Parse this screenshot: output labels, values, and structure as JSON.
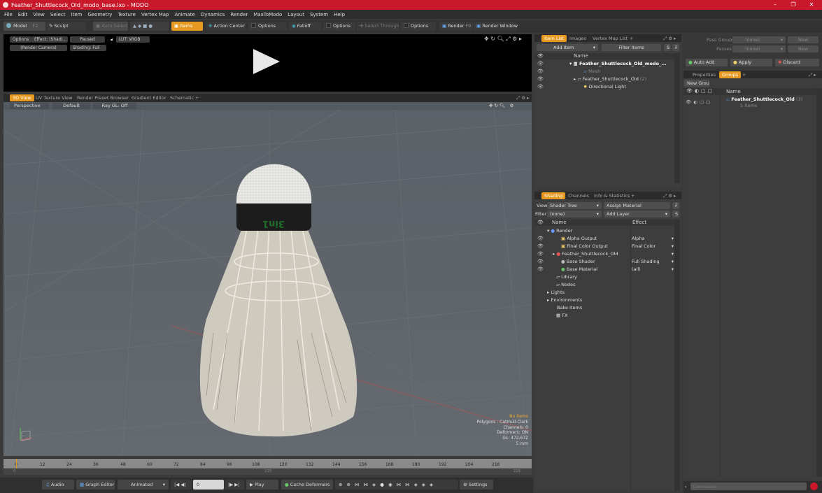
{
  "window": {
    "title": "Feather_Shuttlecock_Old_modo_base.lxo - MODO",
    "min": "–",
    "max": "❐",
    "close": "✕"
  },
  "menu": [
    "File",
    "Edit",
    "View",
    "Select",
    "Item",
    "Geometry",
    "Texture",
    "Vertex Map",
    "Animate",
    "Dynamics",
    "Render",
    "MaxToModo",
    "Layout",
    "System",
    "Help"
  ],
  "toolbar": {
    "model": "Model",
    "f2": "F2",
    "sculpt": "Sculpt",
    "auto_select": "Auto Select",
    "items": "Items",
    "action_center": "Action Center",
    "options1": "Options",
    "falloff": "Falloff",
    "options2": "Options",
    "select_through": "Select Through",
    "options3": "Options",
    "render": "Render",
    "f9": "F9",
    "render_window": "Render Window"
  },
  "preview": {
    "options": "Options",
    "effect": "Effect: (Shadi...",
    "paused": "Paused",
    "lut": "LUT: sRGB",
    "camera": "(Render Camera)",
    "shading": "Shading: Full"
  },
  "viewport_tabs": [
    "3D View",
    "UV Texture View",
    "Render Preset Browser",
    "Gradient Editor",
    "Schematic",
    "+"
  ],
  "viewport": {
    "perspective": "Perspective",
    "default": "Default",
    "raygl": "Ray GL: Off",
    "label_text": "3in1"
  },
  "stats": {
    "items": "No Items",
    "polygons": "Polygons : Catmull-Clark",
    "channels": "Channels: 0",
    "deformers": "Deformers: ON",
    "gl": "GL: 472,672",
    "unit": "5 mm"
  },
  "timeline": {
    "ticks": [
      "0",
      "12",
      "24",
      "36",
      "48",
      "60",
      "72",
      "84",
      "96",
      "108",
      "120",
      "132",
      "144",
      "156",
      "168",
      "180",
      "192",
      "204",
      "216"
    ],
    "mid": "225",
    "end": "225",
    "start": "0"
  },
  "bottombar": {
    "audio": "Audio",
    "graph_editor": "Graph Editor",
    "animated": "Animated",
    "frame": "0",
    "play": "Play",
    "cache": "Cache Deformers",
    "settings": "Settings"
  },
  "itemlist": {
    "tabs": [
      "Item List",
      "Images",
      "Vertex Map List",
      "+"
    ],
    "add_item": "Add Item",
    "filter_items": "Filter Items",
    "s": "S",
    "f": "F",
    "col_name": "Name",
    "rows": [
      {
        "label": "Feather_Shuttlecock_Old_modo_...",
        "extra": ""
      },
      {
        "label": "Mesh",
        "extra": ""
      },
      {
        "label": "Feather_Shuttlecock_Old",
        "extra": "(2)"
      },
      {
        "label": "Directional Light",
        "extra": ""
      }
    ]
  },
  "shading": {
    "tabs": [
      "Shading",
      "Channels",
      "Info & Statistics",
      "+"
    ],
    "view_label": "View",
    "view_value": "Shader Tree",
    "assign_material": "Assign Material",
    "f": "F",
    "filter_label": "Filter",
    "filter_value": "(none)",
    "add_layer": "Add Layer",
    "s": "S",
    "col_name": "Name",
    "col_effect": "Effect",
    "rows": [
      {
        "name": "Render",
        "effect": ""
      },
      {
        "name": "Alpha Output",
        "effect": "Alpha"
      },
      {
        "name": "Final Color Output",
        "effect": "Final Color"
      },
      {
        "name": "Feather_Shuttlecock_Old",
        "effect": ""
      },
      {
        "name": "Base Shader",
        "effect": "Full Shading"
      },
      {
        "name": "Base Material",
        "effect": "(all)"
      },
      {
        "name": "Library",
        "effect": ""
      },
      {
        "name": "Nodes",
        "effect": ""
      },
      {
        "name": "Lights",
        "effect": ""
      },
      {
        "name": "Environments",
        "effect": ""
      },
      {
        "name": "Bake Items",
        "effect": ""
      },
      {
        "name": "FX",
        "effect": ""
      }
    ]
  },
  "passes": {
    "pass_groups": "Pass Groups",
    "passes": "Passes",
    "none1": "(none)",
    "none2": "(none)",
    "new1": "New",
    "new2": "New",
    "auto_add": "Auto Add",
    "apply": "Apply",
    "discard": "Discard"
  },
  "groups": {
    "tabs": [
      "Properties",
      "Groups",
      "+"
    ],
    "new_group": "New Group",
    "col_name": "Name",
    "group_name": "Feather_Shuttlecock_Old",
    "group_count": "(3)",
    "group_items": "5 Items"
  },
  "command": {
    "placeholder": "Command"
  }
}
